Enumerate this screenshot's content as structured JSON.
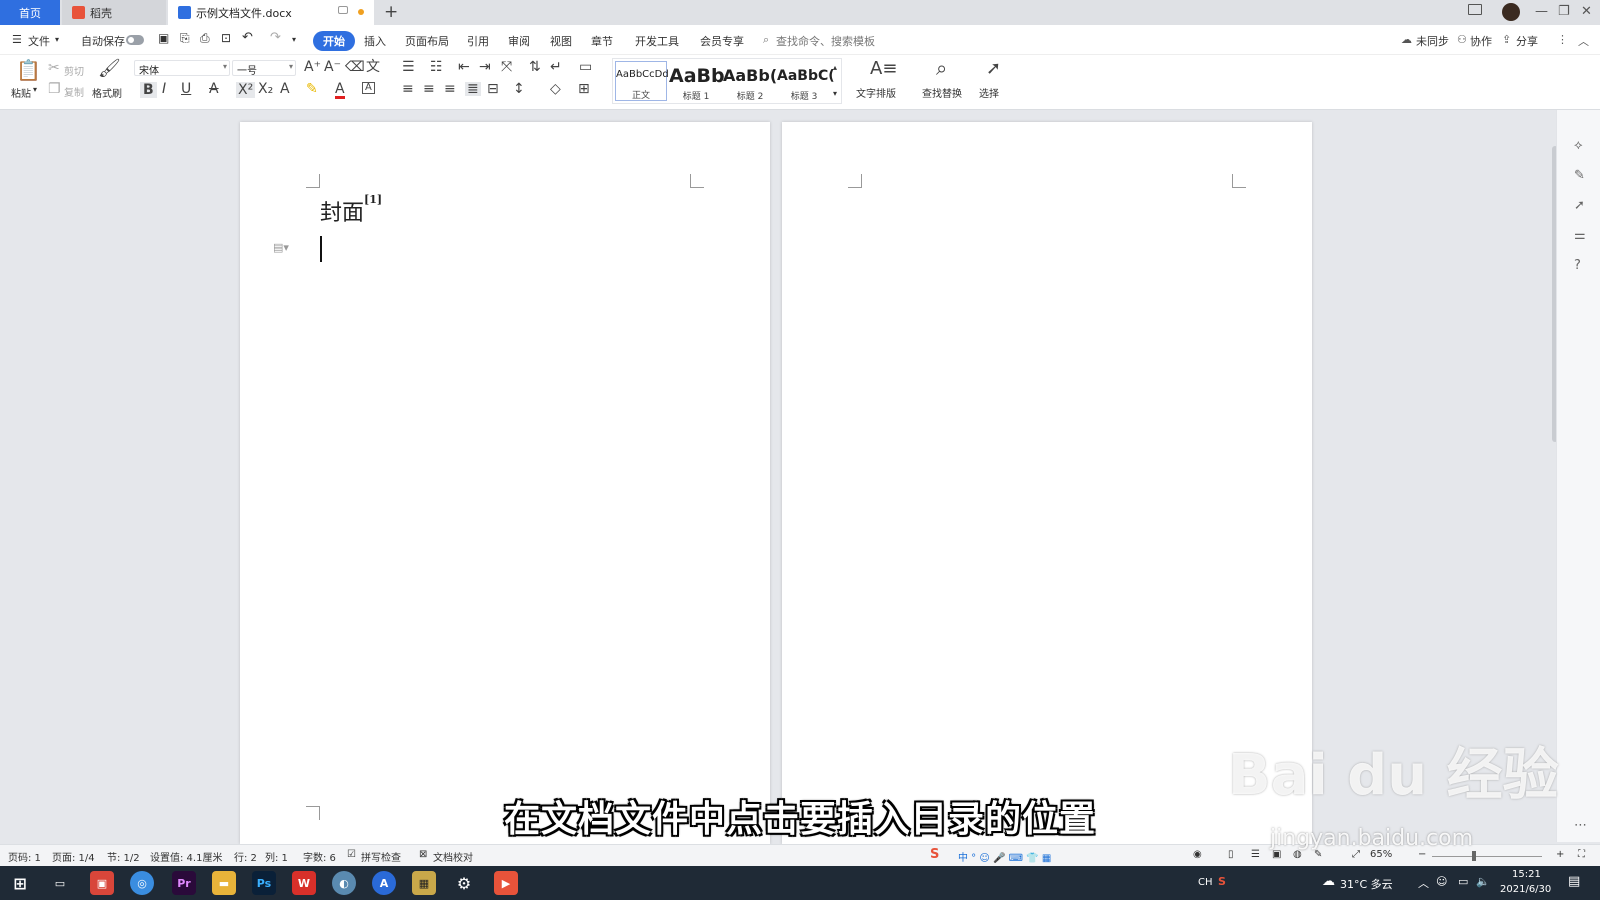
{
  "tabs": {
    "home": "首页",
    "daoke": "稻壳",
    "doc": "示例文档文件.docx"
  },
  "menubar": {
    "file": "文件",
    "autosave": "自动保存",
    "items": [
      "开始",
      "插入",
      "页面布局",
      "引用",
      "审阅",
      "视图",
      "章节",
      "开发工具",
      "会员专享"
    ],
    "search_placeholder": "查找命令、搜索模板",
    "unsynced": "未同步",
    "collab": "协作",
    "share": "分享"
  },
  "ribbon": {
    "paste": "粘贴",
    "cut": "剪切",
    "copy": "复制",
    "format_painter": "格式刷",
    "font_name": "宋体",
    "font_size": "一号",
    "styles": [
      {
        "preview": "AaBbCcDd",
        "name": "正文"
      },
      {
        "preview": "AaBb",
        "name": "标题 1"
      },
      {
        "preview": "AaBb(",
        "name": "标题 2"
      },
      {
        "preview": "AaBbC(",
        "name": "标题 3"
      }
    ],
    "text_layout": "文字排版",
    "find_replace": "查找替换",
    "select": "选择"
  },
  "document": {
    "cover_title": "封面",
    "footnote_ref": "[1]"
  },
  "statusbar": {
    "page_num": "页码: 1",
    "page_count": "页面: 1/4",
    "section": "节: 1/2",
    "setting": "设置值: 4.1厘米",
    "row": "行: 2",
    "col": "列: 1",
    "word_count": "字数: 6",
    "spellcheck": "拼写检查",
    "proofread": "文档校对",
    "zoom": "65%"
  },
  "subtitle": "在文档文件中点击要插入目录的位置",
  "watermark": {
    "logo": "Bai du 经验",
    "url": "jingyan.baidu.com"
  },
  "taskbar": {
    "ime": "CH",
    "weather": "31°C 多云",
    "time": "15:21",
    "date": "2021/6/30"
  },
  "colors": {
    "accent": "#2f6fe0",
    "tab_active": "#ffffff",
    "taskbar": "#1f2a36"
  }
}
